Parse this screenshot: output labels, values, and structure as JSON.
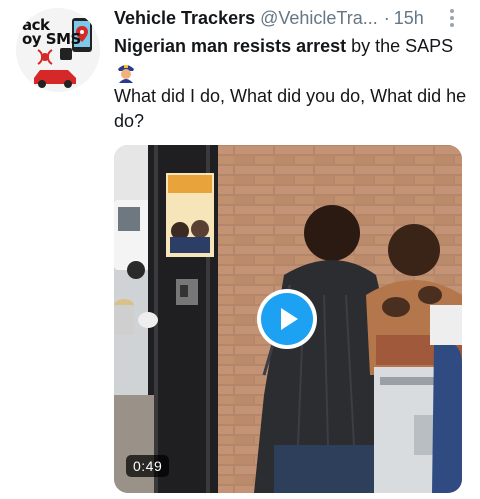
{
  "tweet": {
    "display_name": "Vehicle Trackers",
    "handle": "@VehicleTra...",
    "separator": "·",
    "time": "15h",
    "text_bold": "Nigerian man resists arrest",
    "text_rest": " by the SAPS",
    "emoji": "police-officer-icon",
    "text_line2": "What did I do, What did you do, What did he do?"
  },
  "avatar": {
    "text_line1": "ack",
    "text_line2": "oy SMS"
  },
  "media": {
    "poster_text": "ilaya",
    "duration": "0:49"
  },
  "colors": {
    "accent": "#1da1f2",
    "text": "#14171a",
    "muted": "#657786",
    "brick": "#b5876a",
    "jacket": "#2b2d31"
  }
}
